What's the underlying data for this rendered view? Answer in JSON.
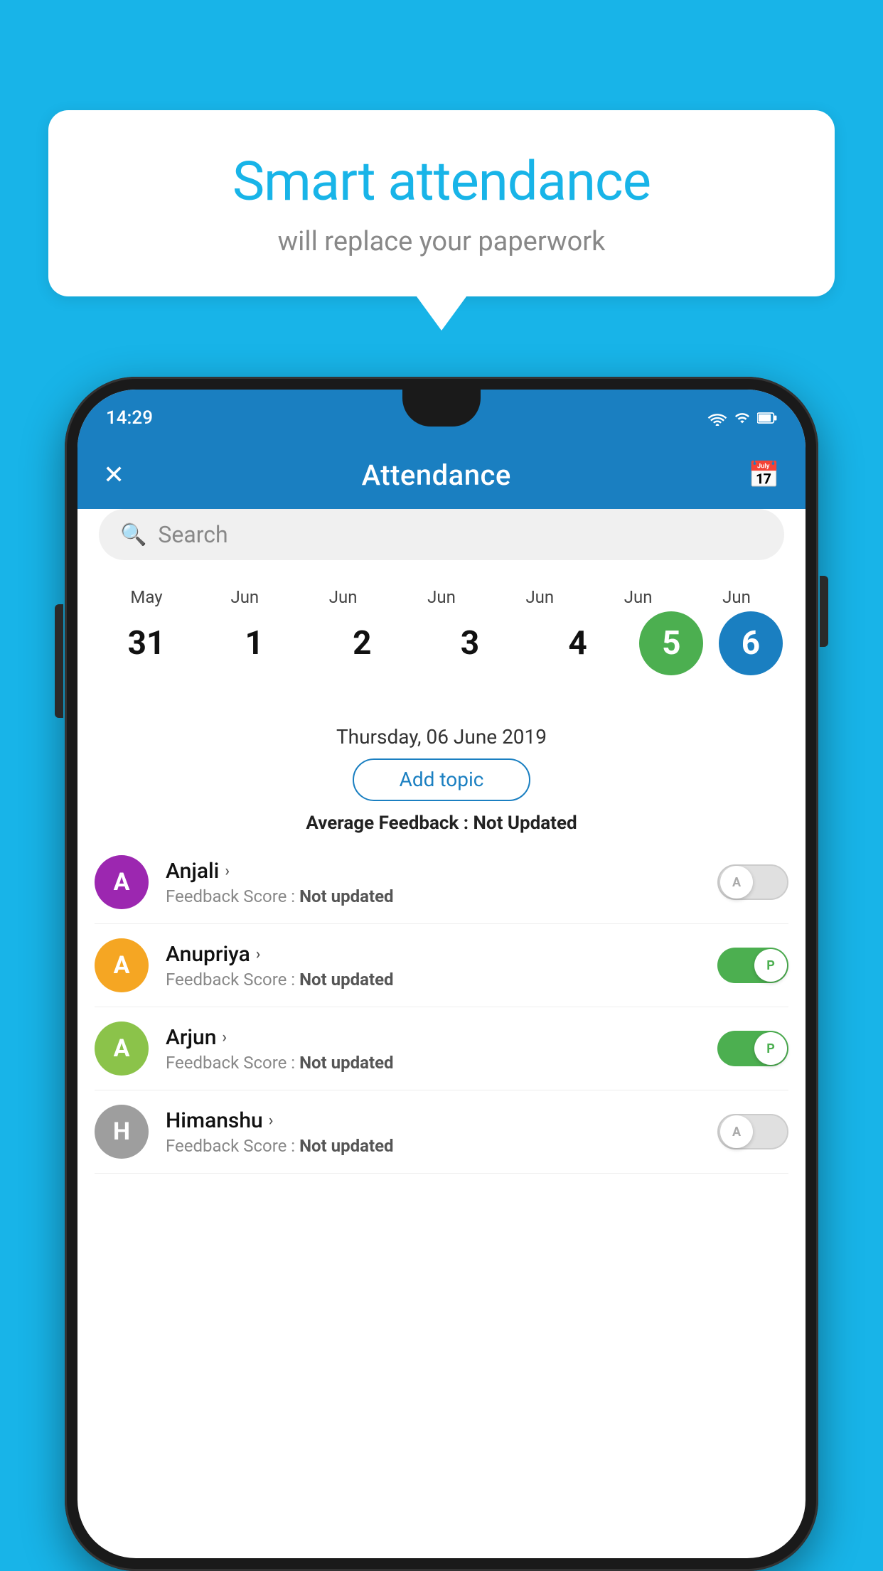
{
  "background_color": "#18b4e8",
  "bubble": {
    "title": "Smart attendance",
    "subtitle": "will replace your paperwork"
  },
  "status_bar": {
    "time": "14:29",
    "wifi_icon": "wifi",
    "signal_icon": "signal",
    "battery_icon": "battery"
  },
  "header": {
    "title": "Attendance",
    "close_label": "✕",
    "calendar_label": "📅"
  },
  "search": {
    "placeholder": "Search"
  },
  "calendar": {
    "months": [
      "May",
      "Jun",
      "Jun",
      "Jun",
      "Jun",
      "Jun",
      "Jun"
    ],
    "dates": [
      "31",
      "1",
      "2",
      "3",
      "4",
      "5",
      "6"
    ],
    "today_index": 5,
    "selected_index": 6
  },
  "selected_date": "Thursday, 06 June 2019",
  "add_topic_label": "Add topic",
  "avg_feedback_label": "Average Feedback :",
  "avg_feedback_value": "Not Updated",
  "students": [
    {
      "name": "Anjali",
      "initial": "A",
      "avatar_color": "#9c27b0",
      "feedback_label": "Feedback Score :",
      "feedback_value": "Not updated",
      "toggle_state": "off",
      "toggle_letter": "A"
    },
    {
      "name": "Anupriya",
      "initial": "A",
      "avatar_color": "#f5a623",
      "feedback_label": "Feedback Score :",
      "feedback_value": "Not updated",
      "toggle_state": "on",
      "toggle_letter": "P"
    },
    {
      "name": "Arjun",
      "initial": "A",
      "avatar_color": "#8bc34a",
      "feedback_label": "Feedback Score :",
      "feedback_value": "Not updated",
      "toggle_state": "on",
      "toggle_letter": "P"
    },
    {
      "name": "Himanshu",
      "initial": "H",
      "avatar_color": "#9e9e9e",
      "feedback_label": "Feedback Score :",
      "feedback_value": "Not updated",
      "toggle_state": "off",
      "toggle_letter": "A"
    }
  ]
}
